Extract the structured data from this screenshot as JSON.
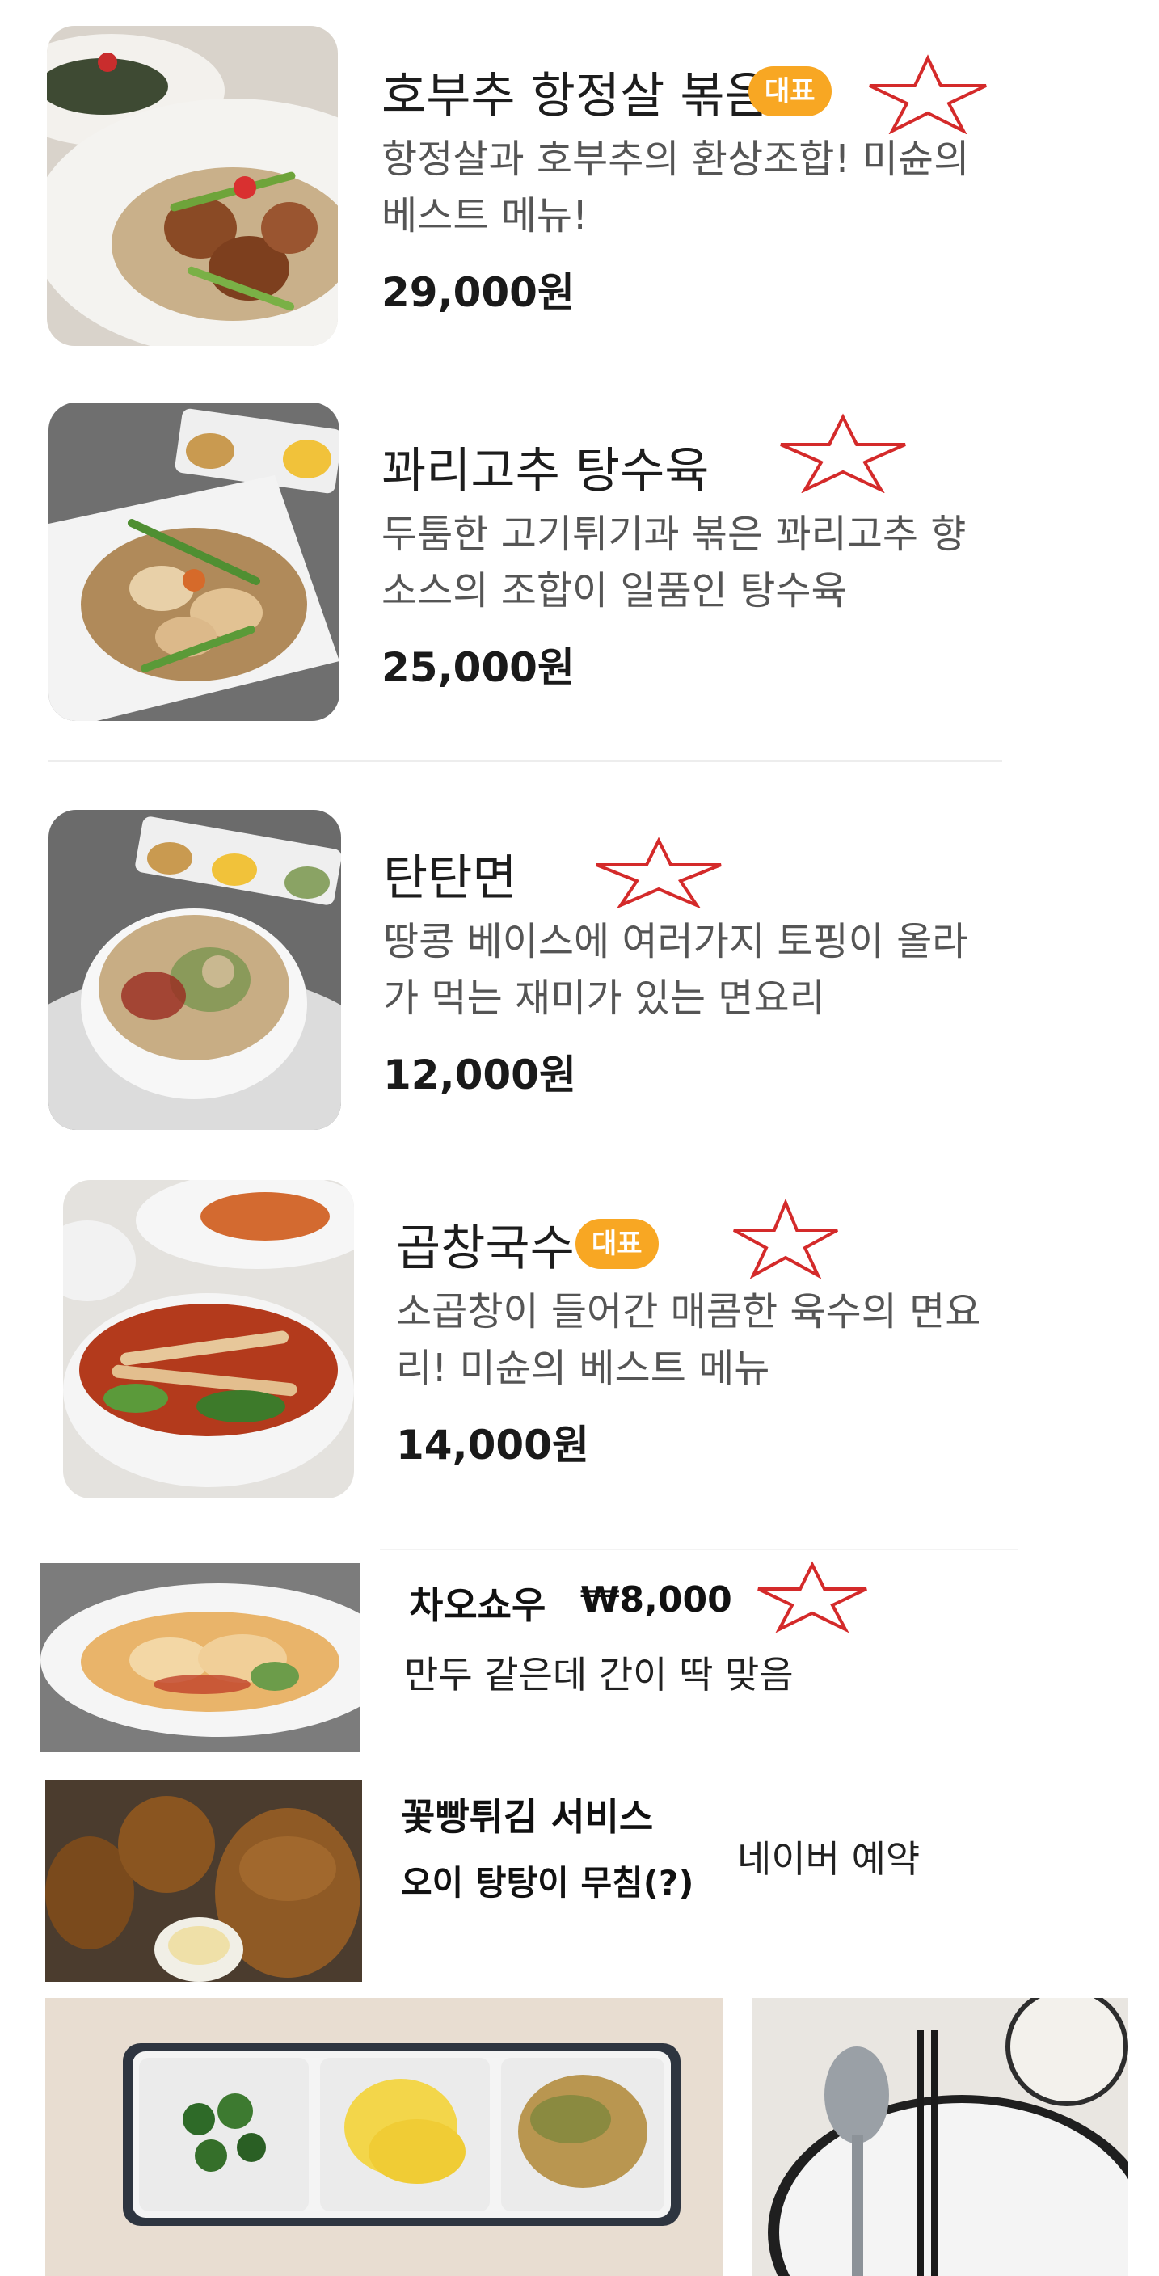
{
  "menu": [
    {
      "name": "호부추 항정살 볶음",
      "badge": "대표",
      "desc": "항정살과 호부추의 환상조합! 미슌의 베스트 메뉴!",
      "price": "29,000원"
    },
    {
      "name": "꽈리고추 탕수육",
      "badge": "",
      "desc": "두툼한 고기튀기과 볶은 꽈리고추 향 소스의 조합이 일품인 탕수육",
      "price": "25,000원"
    },
    {
      "name": "탄탄면",
      "badge": "",
      "desc": "땅콩 베이스에 여러가지 토핑이 올라 가 먹는 재미가 있는 면요리",
      "price": "12,000원"
    },
    {
      "name": "곱창국수",
      "badge": "대표",
      "desc": "소곱창이 들어간 매콤한 육수의 면요 리! 미슌의 베스트 메뉴",
      "price": "14,000원"
    }
  ],
  "extra1": {
    "name": "차오쇼우",
    "price": "₩8,000",
    "desc": "만두 같은데 간이 딱 맞음"
  },
  "extra2": {
    "line1": "꽃빵튀김 서비스",
    "line2": "오이 탕탕이 무침(?)",
    "side": "네이버 예약"
  },
  "colors": {
    "badge": "#f8a723",
    "star": "#d42a2a"
  }
}
